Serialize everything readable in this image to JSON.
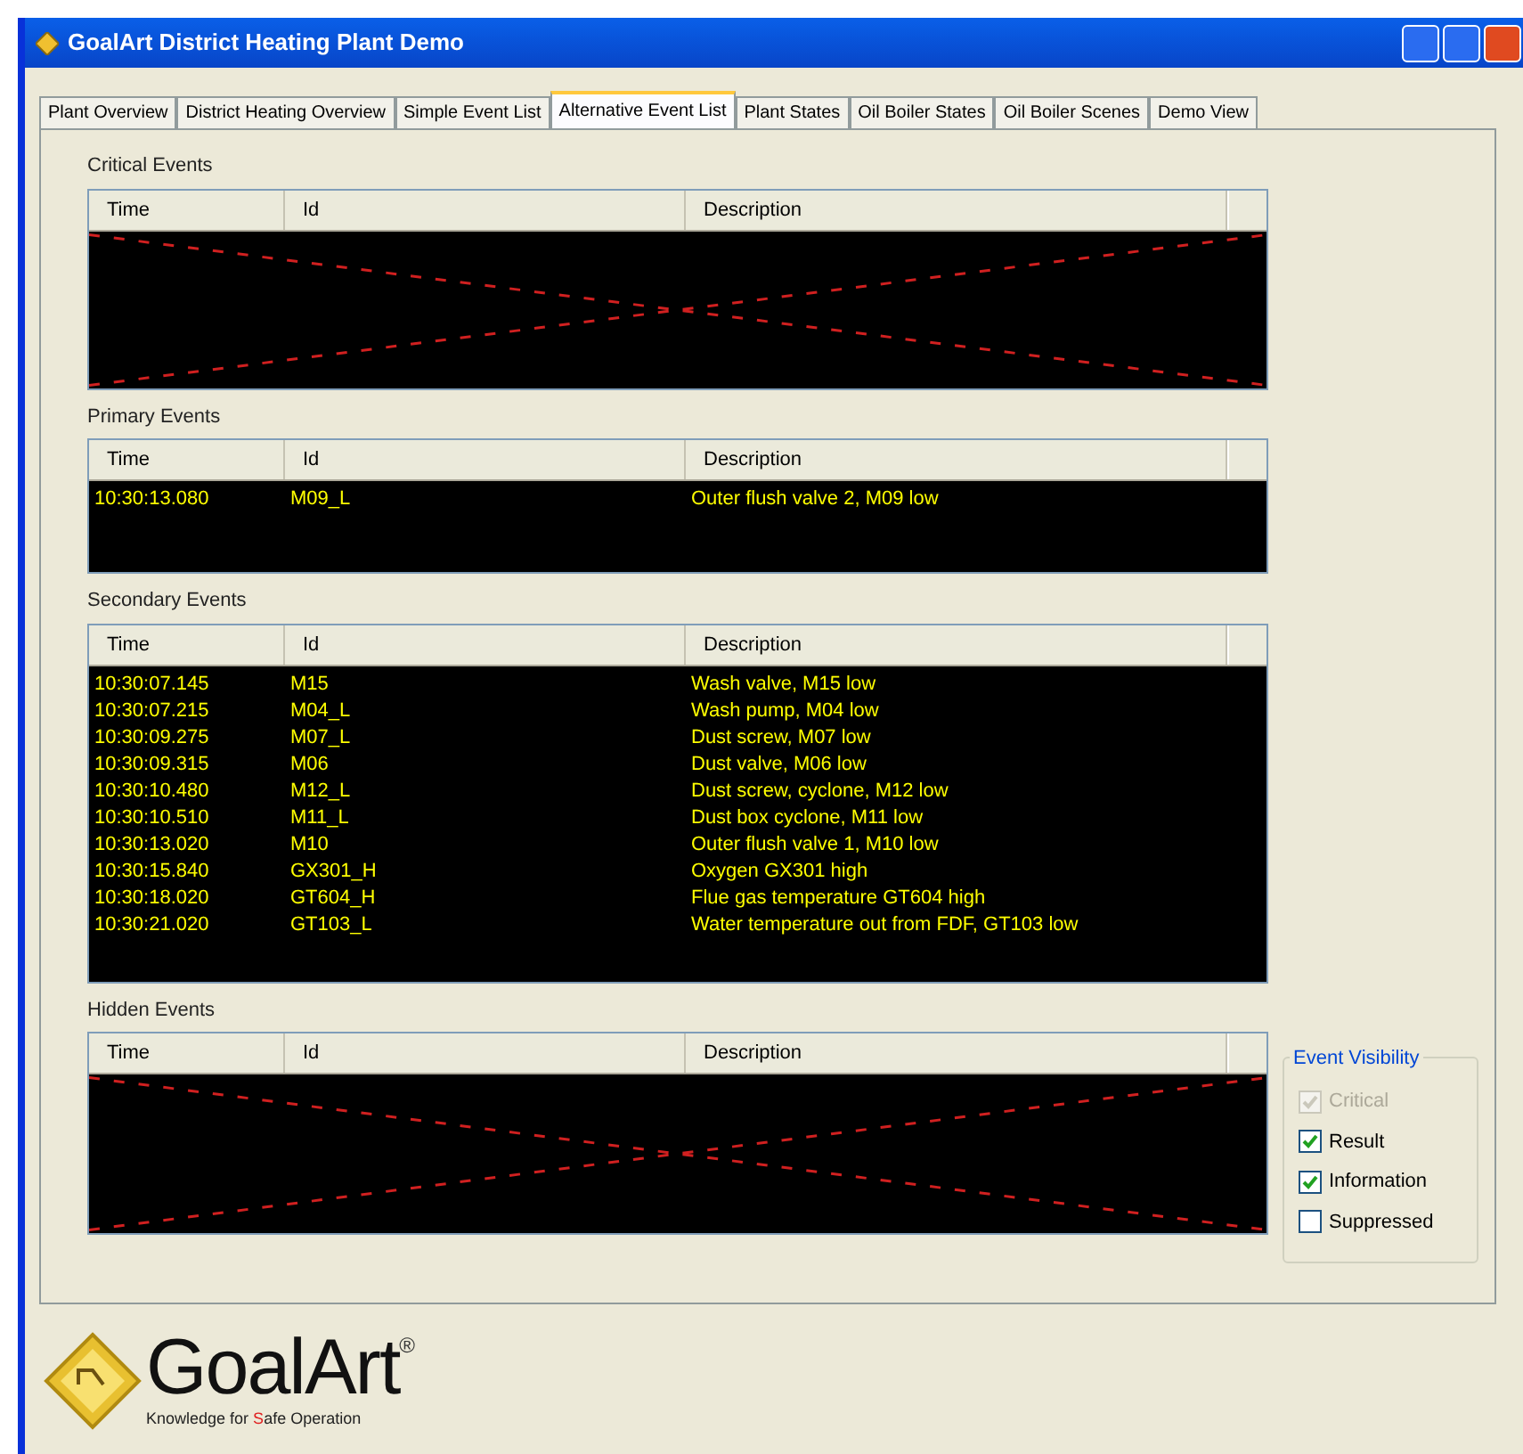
{
  "window": {
    "title": "GoalArt District Heating Plant Demo"
  },
  "tabs": [
    {
      "label": "Plant Overview",
      "selected": false
    },
    {
      "label": "District Heating Overview",
      "selected": false
    },
    {
      "label": "Simple Event List",
      "selected": false
    },
    {
      "label": "Alternative Event List",
      "selected": true
    },
    {
      "label": "Plant States",
      "selected": false
    },
    {
      "label": "Oil Boiler States",
      "selected": false
    },
    {
      "label": "Oil Boiler Scenes",
      "selected": false
    },
    {
      "label": "Demo View",
      "selected": false
    }
  ],
  "event_tables": [
    {
      "title": "Critical Events",
      "columns": [
        "Time",
        "Id",
        "Description"
      ]
    },
    {
      "title": "Primary Events",
      "columns": [
        "Time",
        "Id",
        "Description"
      ],
      "rows": [
        [
          "10:30:13.080",
          "M09_L",
          "Outer flush valve 2, M09 low"
        ]
      ]
    },
    {
      "title": "Secondary Events",
      "columns": [
        "Time",
        "Id",
        "Description"
      ],
      "rows": [
        [
          "10:30:07.145",
          "M15",
          "Wash valve, M15 low"
        ],
        [
          "10:30:07.215",
          "M04_L",
          "Wash pump, M04 low"
        ],
        [
          "10:30:09.275",
          "M07_L",
          "Dust screw, M07 low"
        ],
        [
          "10:30:09.315",
          "M06",
          "Dust valve, M06 low"
        ],
        [
          "10:30:10.480",
          "M12_L",
          "Dust screw, cyclone, M12 low"
        ],
        [
          "10:30:10.510",
          "M11_L",
          "Dust box cyclone, M11 low"
        ],
        [
          "10:30:13.020",
          "M10",
          "Outer flush valve 1, M10 low"
        ],
        [
          "10:30:15.840",
          "GX301_H",
          "Oxygen GX301 high"
        ],
        [
          "10:30:18.020",
          "GT604_H",
          "Flue gas temperature GT604 high"
        ],
        [
          "10:30:21.020",
          "GT103_L",
          "Water temperature out from FDF, GT103 low"
        ]
      ]
    },
    {
      "title": "Hidden Events",
      "columns": [
        "Time",
        "Id",
        "Description"
      ]
    }
  ],
  "filter": {
    "title": "Event Visibility",
    "options": [
      {
        "label": "Critical",
        "checked": true,
        "disabled": true
      },
      {
        "label": "Result",
        "checked": true,
        "disabled": false
      },
      {
        "label": "Information",
        "checked": true,
        "disabled": false
      },
      {
        "label": "Suppressed",
        "checked": false,
        "disabled": false
      }
    ]
  },
  "logo": {
    "name": "GoalArt",
    "mark": "®",
    "tagline": "Knowledge for **S**afe Operation"
  }
}
